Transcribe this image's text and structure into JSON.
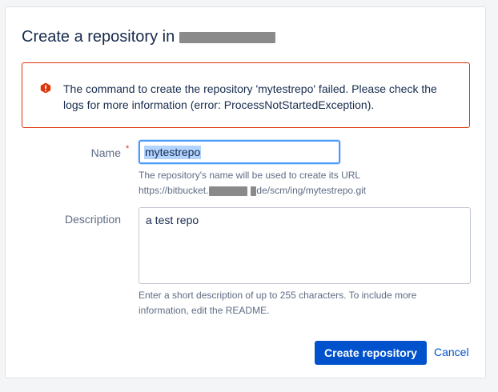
{
  "page": {
    "title": "Create a repository in"
  },
  "error": {
    "message": "The command to create the repository 'mytestrepo' failed. Please check the logs for more information (error: ProcessNotStartedException).",
    "icon": "warning-icon",
    "color": "#de350b"
  },
  "form": {
    "name": {
      "label": "Name",
      "required_marker": "*",
      "value": "mytestrepo",
      "help_line1": "The repository's name will be used to create its URL",
      "url_prefix": "https://bitbucket.",
      "url_suffix": "de/scm/ing/mytestrepo.git"
    },
    "description": {
      "label": "Description",
      "value": "a test repo",
      "help": "Enter a short description of up to 255 characters. To include more information, edit the README."
    }
  },
  "actions": {
    "create_label": "Create repository",
    "cancel_label": "Cancel",
    "primary_color": "#0052cc"
  }
}
